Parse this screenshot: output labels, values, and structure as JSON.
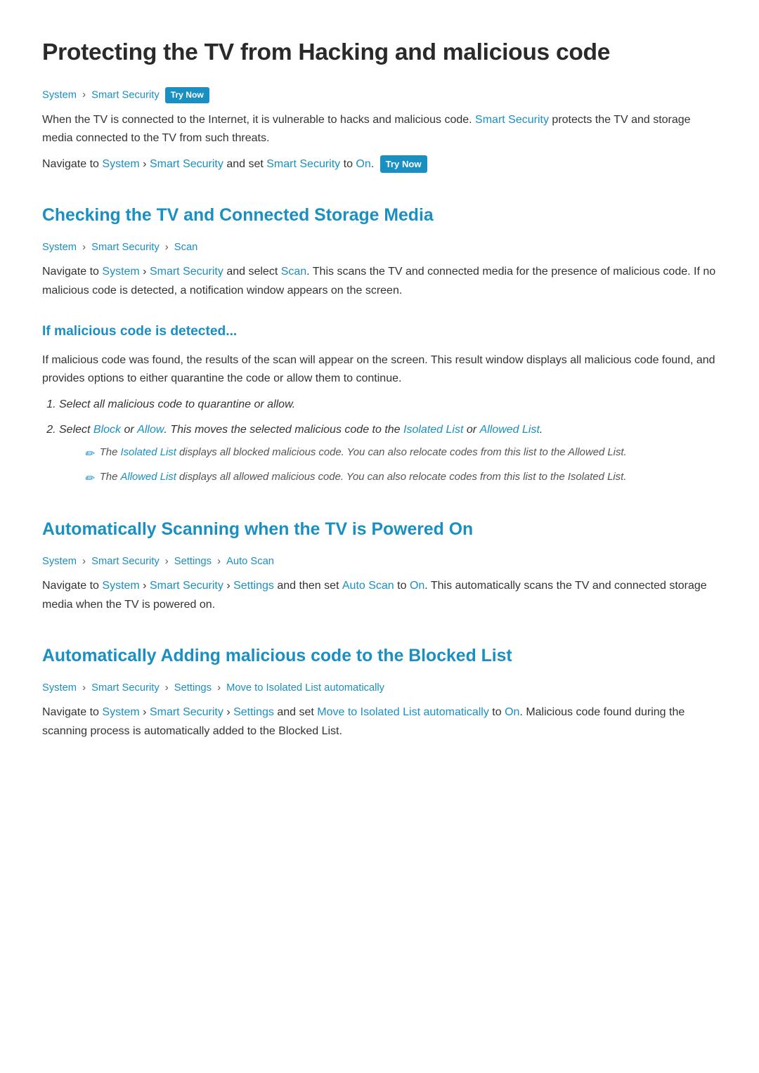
{
  "page": {
    "title": "Protecting the TV from Hacking and malicious code",
    "sections": [
      {
        "id": "intro",
        "breadcrumb": [
          "System",
          "Smart Security"
        ],
        "breadcrumb_has_trynow": true,
        "paragraphs": [
          "When the TV is connected to the Internet, it is vulnerable to hacks and malicious code. Smart Security protects the TV and storage media connected to the TV from such threats.",
          "Navigate to System > Smart Security and set Smart Security to On."
        ],
        "paragraph2_trynow": true
      },
      {
        "id": "checking",
        "heading": "Checking the TV and Connected Storage Media",
        "breadcrumb": [
          "System",
          "Smart Security",
          "Scan"
        ],
        "paragraphs": [
          "Navigate to System > Smart Security and select Scan. This scans the TV and connected media for the presence of malicious code. If no malicious code is detected, a notification window appears on the screen."
        ]
      },
      {
        "id": "if-detected",
        "subheading": "If malicious code is detected...",
        "paragraphs": [
          "If malicious code was found, the results of the scan will appear on the screen. This result window displays all malicious code found, and provides options to either quarantine the code or allow them to continue."
        ],
        "steps": [
          {
            "text": "Select all malicious code to quarantine or allow."
          },
          {
            "text": "Select Block or Allow. This moves the selected malicious code to the Isolated List or Allowed List.",
            "notes": [
              "The Isolated List displays all blocked malicious code. You can also relocate codes from this list to the Allowed List.",
              "The Allowed List displays all allowed malicious code. You can also relocate codes from this list to the Isolated List."
            ]
          }
        ]
      },
      {
        "id": "auto-scan",
        "heading": "Automatically Scanning when the TV is Powered On",
        "breadcrumb": [
          "System",
          "Smart Security",
          "Settings",
          "Auto Scan"
        ],
        "paragraphs": [
          "Navigate to System > Smart Security > Settings and then set Auto Scan to On. This automatically scans the TV and connected storage media when the TV is powered on."
        ]
      },
      {
        "id": "auto-block",
        "heading": "Automatically Adding malicious code to the Blocked List",
        "breadcrumb": [
          "System",
          "Smart Security",
          "Settings",
          "Move to Isolated List automatically"
        ],
        "paragraphs": [
          "Navigate to System > Smart Security > Settings and set Move to Isolated List automatically to On. Malicious code found during the scanning process is automatically added to the Blocked List."
        ]
      }
    ]
  },
  "labels": {
    "try_now": "Try Now",
    "system": "System",
    "smart_security": "Smart Security",
    "scan": "Scan",
    "settings": "Settings",
    "auto_scan": "Auto Scan",
    "on": "On",
    "block": "Block",
    "allow": "Allow",
    "isolated_list": "Isolated List",
    "allowed_list": "Allowed List",
    "move_to_isolated": "Move to Isolated List automatically"
  }
}
